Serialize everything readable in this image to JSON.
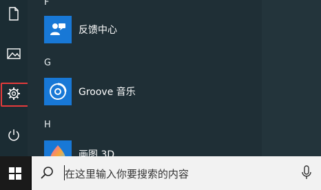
{
  "start_menu": {
    "rail": {
      "items": [
        {
          "name": "documents",
          "icon": "document-icon"
        },
        {
          "name": "pictures",
          "icon": "picture-icon"
        },
        {
          "name": "settings",
          "icon": "gear-icon"
        },
        {
          "name": "power",
          "icon": "power-icon"
        }
      ]
    },
    "app_list": {
      "sections": [
        {
          "letter": "F",
          "apps": [
            {
              "label": "反馈中心",
              "icon": "feedback-hub-icon"
            }
          ]
        },
        {
          "letter": "G",
          "apps": [
            {
              "label": "Groove 音乐",
              "icon": "groove-music-icon"
            }
          ]
        },
        {
          "letter": "H",
          "apps": [
            {
              "label": "画图 3D",
              "icon": "paint-3d-icon"
            }
          ]
        }
      ]
    }
  },
  "taskbar": {
    "start_icon": "windows-logo-icon",
    "search": {
      "placeholder": "在这里输入你要搜索的内容",
      "search_icon": "search-icon",
      "mic_icon": "microphone-icon"
    }
  },
  "colors": {
    "tile_blue": "#1878d6",
    "highlight_red": "#e63b3b"
  }
}
